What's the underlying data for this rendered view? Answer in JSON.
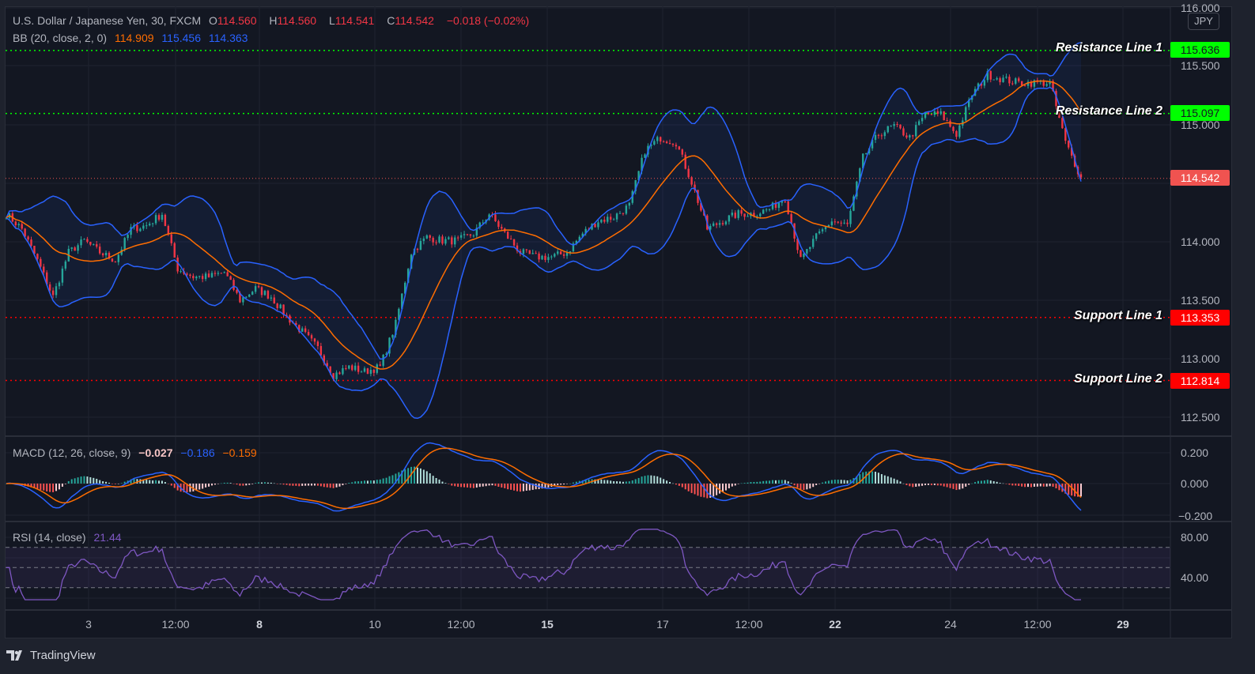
{
  "header": {
    "symbol": "U.S. Dollar / Japanese Yen, 30, FXCM",
    "o_label": "O",
    "open": "114.560",
    "h_label": "H",
    "high": "114.560",
    "l_label": "L",
    "low": "114.541",
    "c_label": "C",
    "close": "114.542",
    "change": "−0.018 (−0.02%)",
    "bb_label": "BB (20, close, 2, 0)",
    "bb_basis": "114.909",
    "bb_upper": "115.456",
    "bb_lower": "114.363"
  },
  "macd": {
    "label": "MACD (12, 26, close, 9)",
    "hist": "−0.027",
    "macd": "−0.186",
    "signal": "−0.159",
    "ticks": [
      "0.200",
      "0.000",
      "−0.200"
    ]
  },
  "rsi": {
    "label": "RSI (14, close)",
    "value": "21.44",
    "ticks": [
      "80.00",
      "40.00"
    ]
  },
  "price_axis": {
    "currency": "JPY",
    "ticks": [
      "116.000",
      "115.500",
      "115.000",
      "114.000",
      "113.500",
      "113.000",
      "112.500"
    ],
    "last_price": "114.542"
  },
  "levels": [
    {
      "label": "Resistance Line 1",
      "value": "115.636",
      "color": "#00ff00"
    },
    {
      "label": "Resistance Line 2",
      "value": "115.097",
      "color": "#00ff00"
    },
    {
      "label": "Support Line 1",
      "value": "113.353",
      "color": "#ff0000"
    },
    {
      "label": "Support Line 2",
      "value": "112.814",
      "color": "#ff0000"
    }
  ],
  "time_axis": {
    "ticks": [
      "3",
      "12:00",
      "8",
      "10",
      "12:00",
      "15",
      "17",
      "12:00",
      "22",
      "24",
      "12:00",
      "29"
    ]
  },
  "branding": "TradingView",
  "colors": {
    "up": "#26a69a",
    "down": "#f23645",
    "bb_basis": "#ff6d00",
    "bb_band": "#2962ff",
    "rsi": "#7e57c2"
  },
  "chart_data": {
    "type": "candlestick",
    "title": "U.S. Dollar / Japanese Yen, 30, FXCM",
    "ylim": [
      112.35,
      116.0
    ],
    "close_samples": [
      114.24,
      114.11,
      113.84,
      113.53,
      113.91,
      114.01,
      113.91,
      113.84,
      114.11,
      114.14,
      114.24,
      113.77,
      113.7,
      113.7,
      113.74,
      113.5,
      113.6,
      113.53,
      113.36,
      113.23,
      113.09,
      112.86,
      112.93,
      112.89,
      112.93,
      113.3,
      113.91,
      114.04,
      114.01,
      114.01,
      114.07,
      114.24,
      114.07,
      113.91,
      113.87,
      113.87,
      113.91,
      114.07,
      114.18,
      114.21,
      114.31,
      114.78,
      114.89,
      114.85,
      114.51,
      114.11,
      114.18,
      114.24,
      114.24,
      114.28,
      114.38,
      113.84,
      114.04,
      114.18,
      114.14,
      114.72,
      114.92,
      114.99,
      114.89,
      115.09,
      115.09,
      114.92,
      115.26,
      115.43,
      115.39,
      115.36,
      115.36,
      115.36,
      114.85,
      114.55
    ],
    "horizontal_levels": [
      115.636,
      115.097,
      113.353,
      112.814
    ],
    "indicators": [
      "BB (20, close, 2, 0)",
      "MACD (12, 26, close, 9)",
      "RSI (14, close)"
    ],
    "rsi_bands": [
      70,
      50,
      30
    ],
    "grid": true
  }
}
